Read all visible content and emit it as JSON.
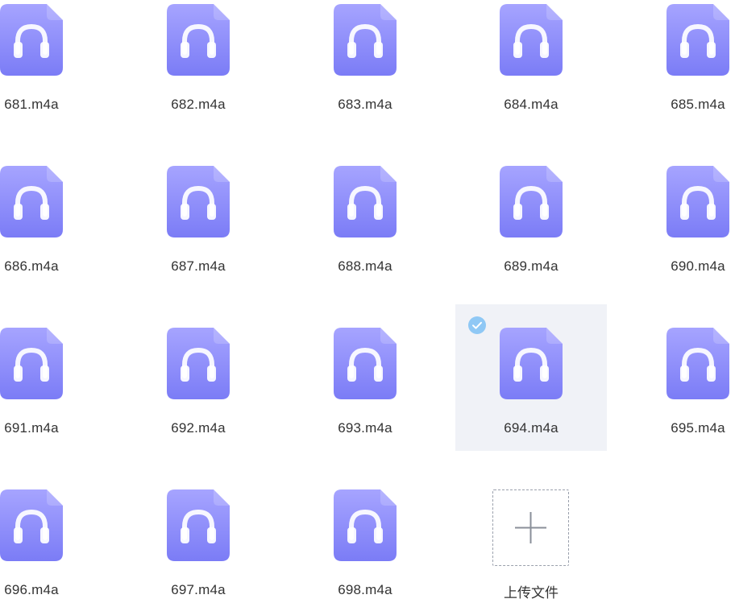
{
  "colors": {
    "icon_top": "#a6a4ff",
    "icon_bottom": "#7b7cf6",
    "selected_bg": "#f0f2f7",
    "check_badge": "#8fc8f5"
  },
  "file_icon": "headphones-audio-file-icon",
  "files": [
    {
      "name": "681.m4a",
      "selected": false
    },
    {
      "name": "682.m4a",
      "selected": false
    },
    {
      "name": "683.m4a",
      "selected": false
    },
    {
      "name": "684.m4a",
      "selected": false
    },
    {
      "name": "685.m4a",
      "selected": false
    },
    {
      "name": "686.m4a",
      "selected": false
    },
    {
      "name": "687.m4a",
      "selected": false
    },
    {
      "name": "688.m4a",
      "selected": false
    },
    {
      "name": "689.m4a",
      "selected": false
    },
    {
      "name": "690.m4a",
      "selected": false
    },
    {
      "name": "691.m4a",
      "selected": false
    },
    {
      "name": "692.m4a",
      "selected": false
    },
    {
      "name": "693.m4a",
      "selected": false
    },
    {
      "name": "694.m4a",
      "selected": true
    },
    {
      "name": "695.m4a",
      "selected": false
    },
    {
      "name": "696.m4a",
      "selected": false
    },
    {
      "name": "697.m4a",
      "selected": false
    },
    {
      "name": "698.m4a",
      "selected": false
    }
  ],
  "upload": {
    "label": "上传文件",
    "icon": "plus-icon"
  }
}
